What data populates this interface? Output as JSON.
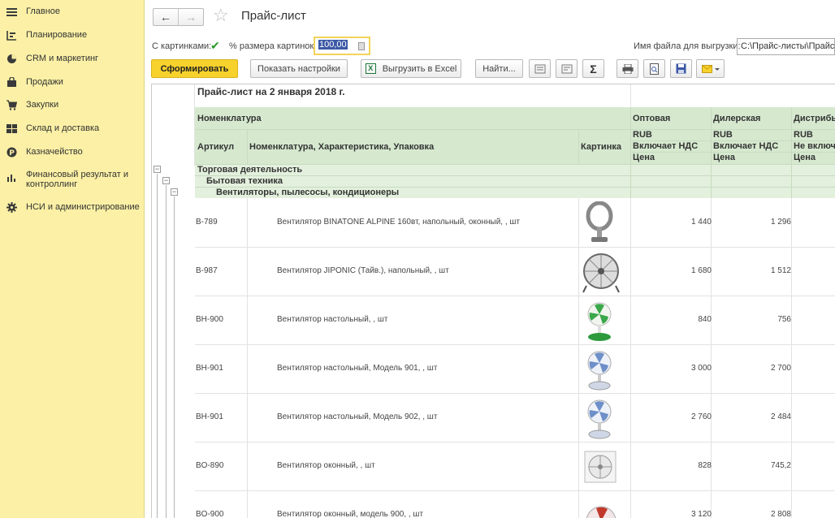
{
  "sidebar": {
    "items": [
      {
        "label": "Главное",
        "icon": "menu-icon"
      },
      {
        "label": "Планирование",
        "icon": "planning-icon"
      },
      {
        "label": "CRM и маркетинг",
        "icon": "pie-chart-icon"
      },
      {
        "label": "Продажи",
        "icon": "bag-icon"
      },
      {
        "label": "Закупки",
        "icon": "cart-icon"
      },
      {
        "label": "Склад и доставка",
        "icon": "warehouse-icon"
      },
      {
        "label": "Казначейство",
        "icon": "coin-icon"
      },
      {
        "label": "Финансовый результат и контроллинг",
        "icon": "bar-chart-icon"
      },
      {
        "label": "НСИ и администрирование",
        "icon": "gear-icon"
      }
    ]
  },
  "header": {
    "back": "←",
    "forward": "→",
    "star": "☆",
    "title": "Прайс-лист"
  },
  "options": {
    "with_pictures_label": "С картинками:",
    "with_pictures_checked": "✔",
    "pic_size_label": "% размера картинок:",
    "pic_size_value": "100,00",
    "file_label": "Имя файла для выгрузки:",
    "file_value": "C:\\Прайс-листы\\Прайс-л"
  },
  "toolbar": {
    "generate": "Сформировать",
    "show_settings": "Показать настройки",
    "export_excel": "Выгрузить в Excel",
    "excel_glyph": "X",
    "find": "Найти...",
    "sigma": "Σ"
  },
  "report": {
    "title": "Прайс-лист на 2 января 2018 г.",
    "col_nomenclature": "Номенклатура",
    "col_article": "Артикул",
    "col_name": "Номенклатура, Характеристика, Упаковка",
    "col_picture": "Картинка",
    "price_cols": [
      {
        "name": "Оптовая",
        "currency": "RUB",
        "vat": "Включает НДС",
        "kind": "Цена"
      },
      {
        "name": "Дилерская",
        "currency": "RUB",
        "vat": "Включает НДС",
        "kind": "Цена"
      },
      {
        "name": "Дистрибь",
        "currency": "RUB",
        "vat": "Не включ",
        "kind": "Цена"
      }
    ],
    "groups": [
      {
        "label": "Торговая деятельность",
        "toggle": "−"
      },
      {
        "label": "Бытовая техника",
        "toggle": "−"
      },
      {
        "label": "Вентиляторы, пылесосы, кондиционеры",
        "toggle": "−"
      }
    ],
    "rows": [
      {
        "article": "B-789",
        "name": "Вентилятор BINATONE ALPINE 160вт, напольный, оконный, , шт",
        "p1": "1 440",
        "p2": "1 296",
        "picture": "bladeless-fan"
      },
      {
        "article": "B-987",
        "name": "Вентилятор JIPONIC (Тайв.), напольный, , шт",
        "p1": "1 680",
        "p2": "1 512",
        "picture": "floor-fan"
      },
      {
        "article": "BH-900",
        "name": "Вентилятор настольный, , шт",
        "p1": "840",
        "p2": "756",
        "picture": "desk-fan-green"
      },
      {
        "article": "BH-901",
        "name": "Вентилятор настольный, Модель 901, , шт",
        "p1": "3 000",
        "p2": "2 700",
        "picture": "desk-fan-blue"
      },
      {
        "article": "BH-901",
        "name": "Вентилятор настольный, Модель 902, , шт",
        "p1": "2 760",
        "p2": "2 484",
        "picture": "desk-fan-blue"
      },
      {
        "article": "BO-890",
        "name": "Вентилятор оконный, , шт",
        "p1": "828",
        "p2": "745,2",
        "picture": "window-fan"
      },
      {
        "article": "BO-900",
        "name": "Вентилятор оконный, модель 900, , шт",
        "p1": "3 120",
        "p2": "2 808",
        "picture": "window-fan-red"
      }
    ]
  }
}
